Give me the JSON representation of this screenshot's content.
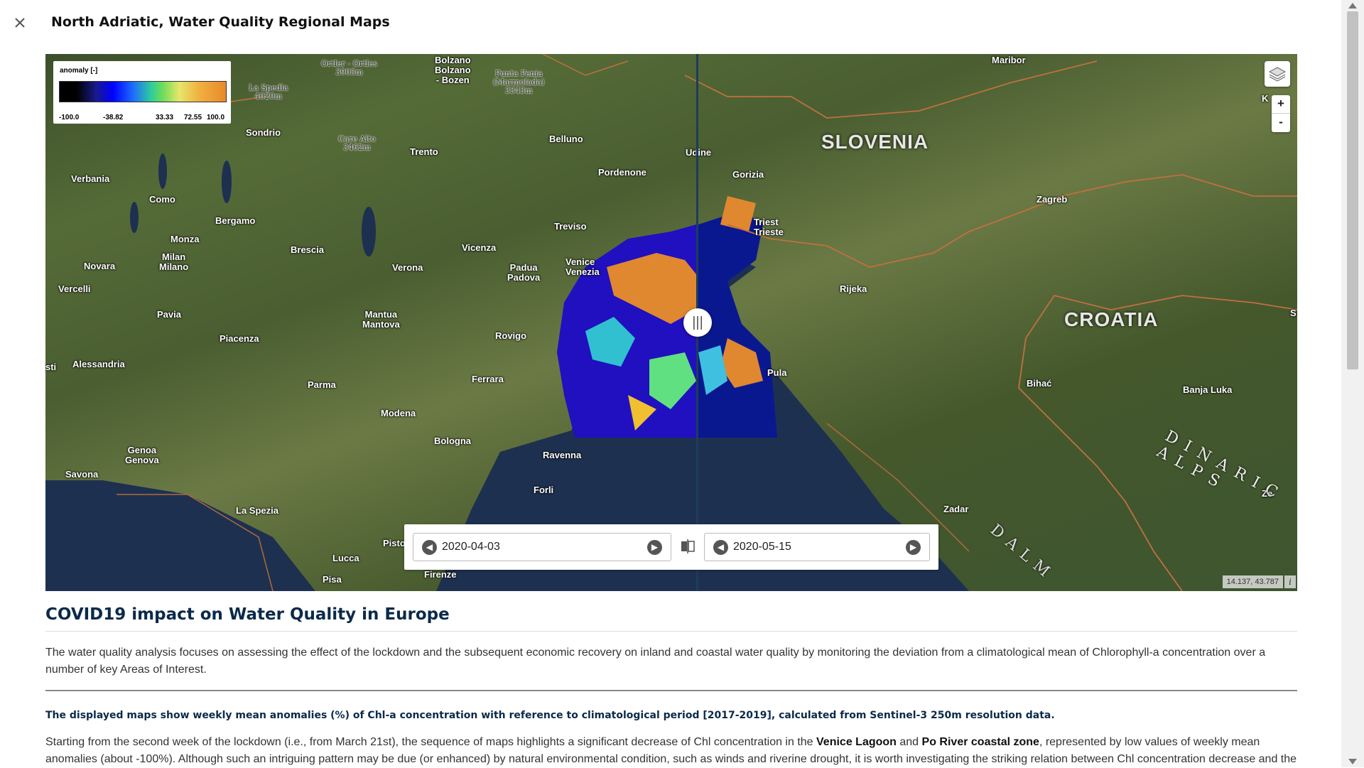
{
  "header": {
    "title": "North Adriatic, Water Quality Regional Maps",
    "close_icon": "close-icon"
  },
  "legend": {
    "title": "anomaly [-]",
    "ticks": [
      "-100.0",
      "-38.82",
      "33.33",
      "72.55",
      "100.0"
    ]
  },
  "map": {
    "countries": [
      "SLOVENIA",
      "CROATIA"
    ],
    "places": {
      "maribor": "Maribor",
      "bolzano": "Bolzano\nBolzano\n- Bozen",
      "sondrio": "Sondrio",
      "belluno": "Belluno",
      "trento": "Trento",
      "verbania": "Verbania",
      "como": "Como",
      "bergamo": "Bergamo",
      "udine": "Udine",
      "pordenone": "Pordenone",
      "gorizia": "Gorizia",
      "zagreb": "Zagreb",
      "monza": "Monza",
      "treviso": "Treviso",
      "triest": "Triest\nTrieste",
      "brescia": "Brescia",
      "milan": "Milan\nMilano",
      "vicenza": "Vicenza",
      "novara": "Novara",
      "verona": "Verona",
      "venice": "Venice\nVenezia",
      "padua": "Padua\nPadova",
      "rijeka": "Rijeka",
      "vercelli": "Vercelli",
      "pavia": "Pavia",
      "mantua": "Mantua\nMantova",
      "rovigo": "Rovigo",
      "piacenza": "Piacenza",
      "alessandria": "Alessandria",
      "pula": "Pula",
      "bihac": "Bihać",
      "banja_luka": "Banja Luka",
      "parma": "Parma",
      "ferrara": "Ferrara",
      "modena": "Modena",
      "bologna": "Bologna",
      "genoa": "Genoa\nGenova",
      "ravenna": "Ravenna",
      "savona": "Savona",
      "forli": "Forli",
      "zadar": "Zadar",
      "la_spezia": "La Spezia",
      "lucca": "Lucca",
      "pisa": "Pisa",
      "pistoia": "Pisto",
      "firenze": "Firenze",
      "asti": "sti",
      "ze": "Ze",
      "k": "K",
      "s": "S"
    },
    "peaks": {
      "ortler": "Ortler - Ortles\n3905m",
      "la_spedla": "La Spedla\n4020m",
      "punta_penia": "Punta Penia\n(Marmolada)\n3343m",
      "care_alto": "Care Alto\n3462m"
    },
    "dinaric": "DINARIC ALPS",
    "dalm": "DALM",
    "coords": "14.137, 43.787",
    "info": "i"
  },
  "dates": {
    "left": "2020-04-03",
    "right": "2020-05-15"
  },
  "content": {
    "heading": "COVID19 impact on Water Quality in Europe",
    "intro": "The water quality analysis focuses on assessing the effect of the lockdown and the subsequent economic recovery on inland and coastal water quality by monitoring the deviation from a climatological mean of Chlorophyll-a concentration over a number of key Areas of Interest.",
    "note": "The displayed maps show weekly mean anomalies (%) of Chl-a concentration with reference to climatological period [2017-2019], calculated from Sentinel-3 250m resolution data.",
    "p2_a": "Starting from the second week of the lockdown (i.e., from March 21st), the sequence of maps highlights a significant decrease of Chl concentration in the ",
    "p2_b": "Venice Lagoon",
    "p2_c": " and ",
    "p2_d": "Po River coastal zone",
    "p2_e": ", represented by low values of weekly mean anomalies (about -100%). Although such an intriguing pattern may be due (or enhanced) by natural environmental condition, such as winds and riverine drought, it is worth investigating the striking relation between Chl concentration decrease and the"
  }
}
